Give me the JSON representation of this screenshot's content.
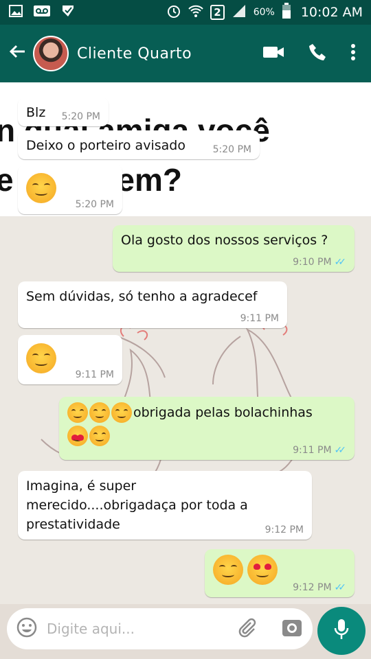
{
  "status_bar": {
    "battery_percent": "60%",
    "time": "10:02 AM",
    "sim_slot": "2"
  },
  "header": {
    "contact_name": "Cliente Quarto",
    "icons": [
      "back-arrow-icon",
      "avatar",
      "video-call-icon",
      "phone-icon",
      "more-vert-icon"
    ]
  },
  "background_text": {
    "line1": "n qual amiga você",
    "line2": "e  tatuagem? "
  },
  "messages": [
    {
      "dir": "in",
      "text": "Blz",
      "time": "5:20 PM"
    },
    {
      "dir": "in",
      "text": "Deixo o porteiro avisado",
      "time": "5:20 PM"
    },
    {
      "dir": "in",
      "text": "",
      "emoji": "smirk",
      "time": "5:20 PM"
    },
    {
      "dir": "out",
      "text": "Ola gosto dos nossos serviços ?",
      "time": "9:10 PM"
    },
    {
      "dir": "in",
      "text": "Sem dúvidas, só tenho a agradecef",
      "time": "9:11 PM"
    },
    {
      "dir": "in",
      "text": "",
      "emoji": "blush",
      "time": "9:11 PM"
    },
    {
      "dir": "out",
      "text": "obrigada pelas bolachinhas",
      "time": "9:11 PM"
    },
    {
      "dir": "in",
      "text": "Imagina, é super merecido....obrigadaça por toda a prestatividade",
      "time": "9:12 PM"
    },
    {
      "dir": "out",
      "text": "",
      "emoji": "blush-hearteyes",
      "time": "9:12 PM"
    }
  ],
  "composer": {
    "placeholder": "Digite aqui...",
    "icons": [
      "emoji-icon",
      "attach-icon",
      "camera-icon",
      "mic-icon"
    ]
  },
  "colors": {
    "status_bar": "#054d44",
    "app_bar": "#075e54",
    "outgoing_bubble": "#dcf8c6",
    "incoming_bubble": "#ffffff",
    "read_ticks": "#4fc3f7",
    "mic_button": "#0a8a7c"
  }
}
